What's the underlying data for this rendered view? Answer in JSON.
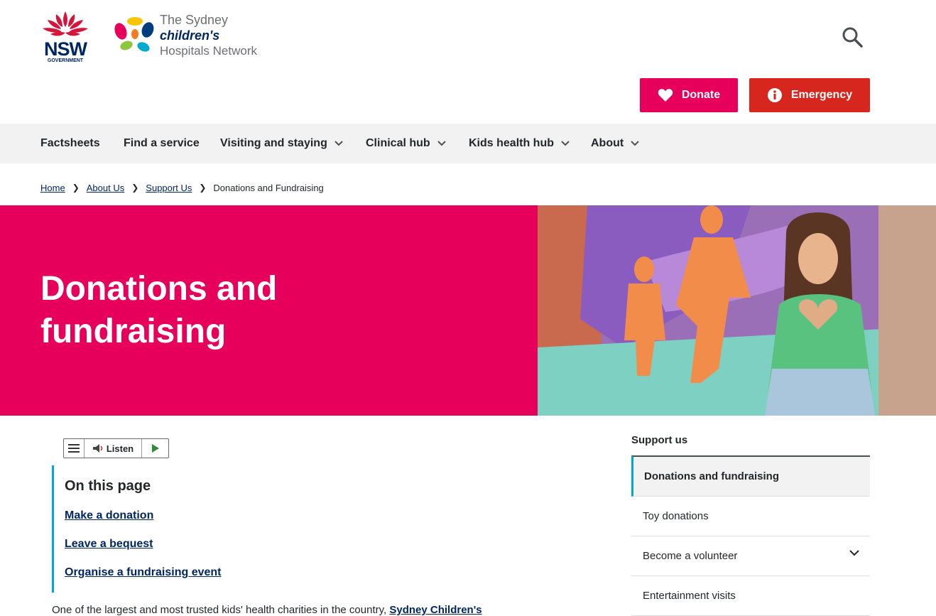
{
  "header": {
    "nsw_logo_text": "NSW",
    "nsw_logo_sub": "GOVERNMENT",
    "schn_line1": "The Sydney",
    "schn_line2": "children's",
    "schn_line3": "Hospitals Network",
    "donate_label": "Donate",
    "emergency_label": "Emergency"
  },
  "nav": {
    "items": [
      {
        "label": "Factsheets"
      },
      {
        "label": "Find a service"
      },
      {
        "label": "Visiting and staying"
      },
      {
        "label": "Clinical hub"
      },
      {
        "label": "Kids health hub"
      },
      {
        "label": "About"
      }
    ]
  },
  "breadcrumb": {
    "items": [
      "Home",
      "About Us",
      "Support Us"
    ],
    "current": "Donations and Fundraising"
  },
  "hero": {
    "title": "Donations and fundraising"
  },
  "listen": {
    "label": "Listen"
  },
  "toc": {
    "title": "On this page",
    "links": [
      "Make a donation",
      "Leave a bequest",
      "Organise a fundraising event"
    ]
  },
  "intro": {
    "text": "One of the largest and most trusted kids' health charities in the country,",
    "link": "Sydney Children's"
  },
  "sidebar": {
    "title": "Support us",
    "items": [
      {
        "label": "Donations and fundraising"
      },
      {
        "label": "Toy donations"
      },
      {
        "label": "Become a volunteer"
      },
      {
        "label": "Entertainment visits"
      }
    ]
  },
  "colors": {
    "brand_pink": "#e6005c",
    "emergency_red": "#d7261e",
    "nsw_navy": "#002664",
    "accent_teal": "#00a9ce"
  }
}
